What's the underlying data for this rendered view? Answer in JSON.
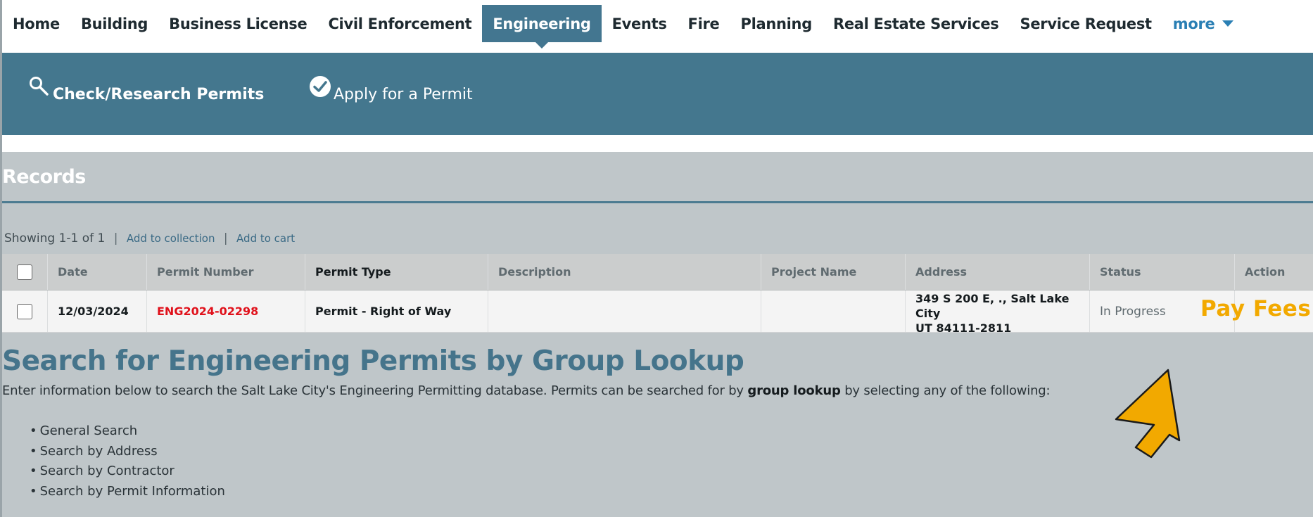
{
  "nav": {
    "tabs": [
      {
        "label": "Home"
      },
      {
        "label": "Building"
      },
      {
        "label": "Business License"
      },
      {
        "label": "Civil Enforcement"
      },
      {
        "label": "Engineering"
      },
      {
        "label": "Events"
      },
      {
        "label": "Fire"
      },
      {
        "label": "Planning"
      },
      {
        "label": "Real Estate Services"
      },
      {
        "label": "Service Request"
      }
    ],
    "active_tab": "Engineering",
    "more_label": "more"
  },
  "actions": {
    "check_research": "Check/Research Permits",
    "apply": "Apply for a Permit"
  },
  "records": {
    "title": "Records",
    "showing": "Showing 1-1 of 1",
    "add_to_collection": "Add to collection",
    "add_to_cart": "Add to cart",
    "columns": {
      "date": "Date",
      "permit_number": "Permit Number",
      "permit_type": "Permit Type",
      "description": "Description",
      "project_name": "Project Name",
      "address": "Address",
      "status": "Status",
      "action": "Action"
    },
    "rows": [
      {
        "date": "12/03/2024",
        "permit_number": "ENG2024-02298",
        "permit_type": "Permit - Right of Way",
        "description": "",
        "project_name": "",
        "address_line1": "349 S 200 E, ., Salt Lake City",
        "address_line2": "UT 84111-2811",
        "status": "In Progress",
        "action": "Pay Fees"
      }
    ]
  },
  "search": {
    "title": "Search for Engineering Permits by Group Lookup",
    "desc_before": "Enter information below to search the Salt Lake City's Engineering Permitting database. Permits can be searched for by ",
    "desc_bold": "group lookup",
    "desc_after": " by selecting any of the following:",
    "options": [
      "General Search",
      "Search by Address",
      "Search by Contractor",
      "Search by Permit Information"
    ]
  },
  "colors": {
    "accent": "#437690",
    "link": "#2a7fb4",
    "permit_red": "#e0101a",
    "pay_fees": "#f2a900",
    "page_bg": "#bfc6c9"
  }
}
